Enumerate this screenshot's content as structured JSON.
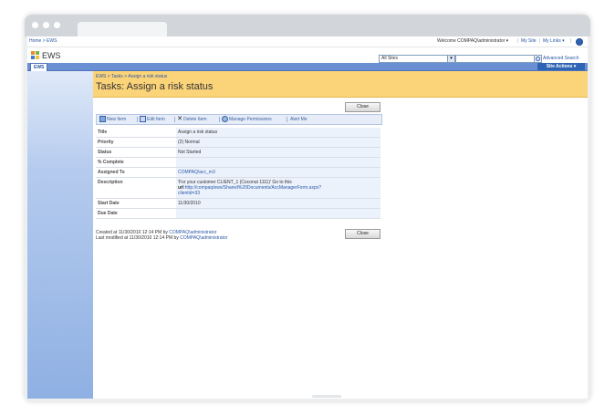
{
  "breadcrumb_top": "Home > EWS",
  "user": {
    "welcome": "Welcome COMPAQ\\administrator",
    "my_site": "My Site",
    "my_links": "My Links"
  },
  "site": {
    "title": "EWS",
    "tab": "EWS",
    "actions": "Site Actions"
  },
  "search": {
    "scope": "All Sites",
    "advanced": "Advanced Search"
  },
  "page": {
    "breadcrumb": "EWS > Tasks > Assign a risk status",
    "title": "Tasks: Assign a risk status"
  },
  "buttons": {
    "close_top": "Close",
    "close_bottom": "Close"
  },
  "toolbar": {
    "new_item": "New Item",
    "edit_item": "Edit Item",
    "delete_item": "Delete Item",
    "manage_permissions": "Manage Permissions",
    "alert_me": "Alert Me"
  },
  "fields": {
    "title": {
      "label": "Title",
      "value": "Assign a risk status"
    },
    "priority": {
      "label": "Priority",
      "value": "(2) Normal"
    },
    "status": {
      "label": "Status",
      "value": "Not Started"
    },
    "percent": {
      "label": "% Complete",
      "value": ""
    },
    "assigned": {
      "label": "Assigned To",
      "value": "COMPAQ\\acc_m3"
    },
    "description": {
      "label": "Description",
      "line1": "'For your customer CLIENT_1 (Coconut 1111)' Go to this",
      "url_label": "url",
      "line2": ":http://compaq/ews/Shared%20Documents/AccManagerForm.aspx?",
      "line3": "clientid=33"
    },
    "start": {
      "label": "Start Date",
      "value": "11/30/2010"
    },
    "due": {
      "label": "Due Date",
      "value": ""
    }
  },
  "footer": {
    "created_prefix": "Created at 11/30/2010 12:14 PM  by",
    "created_by": "COMPAQ\\administrator",
    "modified_prefix": "Last modified at 11/30/2010 12:14 PM  by",
    "modified_by": "COMPAQ\\administrator"
  },
  "colors": {
    "title_band": "#fbd47a",
    "site_bar": "#6b8fd3",
    "link": "#2a57a5"
  }
}
